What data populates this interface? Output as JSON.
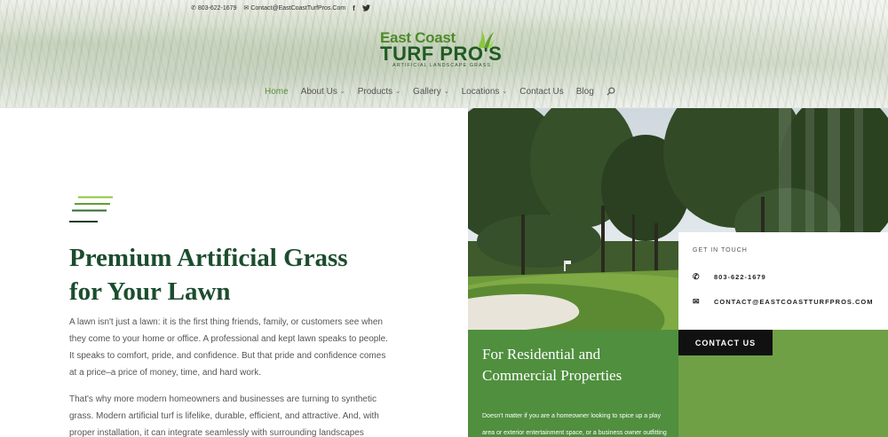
{
  "topbar": {
    "phone": "803-622-1679",
    "email": "Contact@EastCoastTurfPros.Com",
    "social": [
      {
        "icon": "facebook-icon",
        "label": "f"
      },
      {
        "icon": "twitter-icon",
        "label": "🐦"
      }
    ]
  },
  "logo": {
    "line1": "East Coast",
    "line2": "TURF PRO'S",
    "line3": "ARTIFICIAL LANDSCAPE GRASS",
    "colors": {
      "light": "#4d8a2a",
      "dark": "#1f5b22"
    }
  },
  "nav": {
    "items": [
      {
        "label": "Home",
        "active": true,
        "dropdown": false
      },
      {
        "label": "About Us",
        "active": false,
        "dropdown": true
      },
      {
        "label": "Products",
        "active": false,
        "dropdown": true
      },
      {
        "label": "Gallery",
        "active": false,
        "dropdown": true
      },
      {
        "label": "Locations",
        "active": false,
        "dropdown": true
      },
      {
        "label": "Contact Us",
        "active": false,
        "dropdown": false
      },
      {
        "label": "Blog",
        "active": false,
        "dropdown": false
      }
    ],
    "search_icon": "search-icon"
  },
  "hero": {
    "title_line1": "Premium Artificial Grass",
    "title_line2": "for Your Lawn",
    "paragraph1": "A lawn isn't just a lawn: it is the first thing friends, family, or customers see when they come to your home or office. A professional and kept lawn speaks to people. It speaks to comfort, pride, and confidence. But that pride and confidence comes at a price–a price of money, time, and hard work.",
    "paragraph2": "That's why more modern homeowners and businesses are turning to synthetic grass. Modern artificial turf is lifelike, durable, efficient, and attractive. And, with proper installation, it can integrate seamlessly with surrounding landscapes"
  },
  "residential_card": {
    "title_line1": "For Residential and",
    "title_line2": "Commercial Properties",
    "text": "Doesn't matter if you are a homeowner looking to spice up a play area or exterior entertainment space, or a business owner outfitting your office property, artificial grass can make those"
  },
  "contact_card": {
    "label": "GET IN TOUCH",
    "phone": "803-622-1679",
    "email": "CONTACT@EASTCOASTTURFPROS.COM",
    "button": "CONTACT US"
  },
  "colors": {
    "brand_green": "#4f8f3e",
    "title_green": "#1b4d2e",
    "nav_active": "#5a8f3a"
  }
}
